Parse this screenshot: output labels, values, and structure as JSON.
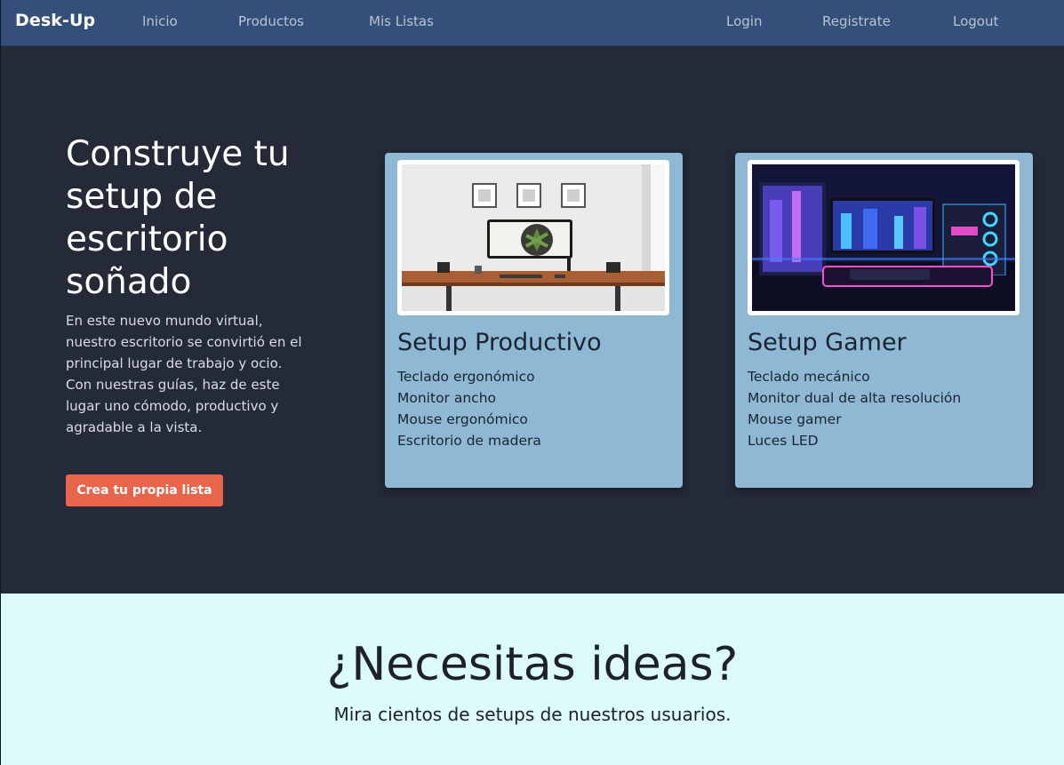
{
  "navbar": {
    "brand": "Desk-Up",
    "links": [
      {
        "label": "Inicio"
      },
      {
        "label": "Productos"
      },
      {
        "label": "Mis Listas"
      },
      {
        "label": "Login"
      },
      {
        "label": "Registrate"
      },
      {
        "label": "Logout"
      }
    ],
    "colors": {
      "background": "#34507a",
      "link": "#b9c3d2"
    }
  },
  "hero": {
    "title": "Construye tu setup de escritorio soñado",
    "text": "En este nuevo mundo virtual, nuestro escritorio se convirtió en el principal lugar de trabajo y ocio. Con nuestras guías, haz de este lugar uno cómodo, productivo y agradable a la vista.",
    "cta_label": "Crea tu propia lista",
    "colors": {
      "background": "#242a37",
      "cta": "#e8644a"
    }
  },
  "cards": [
    {
      "image_alt": "minimal white room desk setup photo",
      "title": "Setup Productivo",
      "items": [
        "Teclado ergonómico",
        "Monitor ancho",
        "Mouse ergonómico",
        "Escritorio de madera"
      ]
    },
    {
      "image_alt": "neon purple and blue gaming setup photo",
      "title": "Setup Gamer",
      "items": [
        "Teclado mecánico",
        "Monitor dual de alta resolución",
        "Mouse gamer",
        "Luces LED"
      ]
    }
  ],
  "ideas": {
    "title": "¿Necesitas ideas?",
    "subtitle": "Mira cientos de setups de nuestros usuarios.",
    "colors": {
      "background": "#dcf9fb"
    }
  }
}
